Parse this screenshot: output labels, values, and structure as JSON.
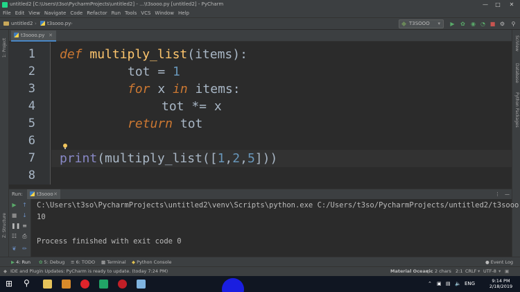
{
  "window": {
    "title": "untitled2 [C:\\Users\\t3so\\PycharmProjects\\untitled2] - ...\\t3sooo.py [untitled2] - PyCharm"
  },
  "menu": [
    "File",
    "Edit",
    "View",
    "Navigate",
    "Code",
    "Refactor",
    "Run",
    "Tools",
    "VCS",
    "Window",
    "Help"
  ],
  "breadcrumb": {
    "project": "untitled2",
    "file": "t3sooo.py"
  },
  "run_config": "T3SOOO",
  "left_strip": {
    "project": "1: Project",
    "structure": "Z: Structure",
    "favorites": "2: Favorites"
  },
  "right_strip": {
    "sciview": "SciView",
    "database": "Database",
    "python_packages": "Python Packages"
  },
  "editor": {
    "tab_label": "t3sooo.py",
    "line_numbers": [
      "1",
      "2",
      "3",
      "4",
      "5",
      "6",
      "7",
      "8"
    ],
    "code": {
      "l1_kw": "def",
      "l1_fn": "multiply_list",
      "l1_rest": "(items):",
      "l2_a": "tot = ",
      "l2_num": "1",
      "l3_kw1": "for",
      "l3_mid": " x ",
      "l3_kw2": "in",
      "l3_rest": " items:",
      "l4": "tot *= x",
      "l5_kw": "return",
      "l5_rest": " tot",
      "l7_bi": "print",
      "l7_a": "(multiply_list([",
      "l7_n1": "1",
      "l7_c1": ",",
      "l7_n2": "2",
      "l7_c2": ",",
      "l7_n3": "5",
      "l7_end": "]))"
    }
  },
  "run_panel": {
    "label": "Run:",
    "tab": "t3sooo",
    "console_lines": [
      "C:\\Users\\t3so\\PycharmProjects\\untitled2\\venv\\Scripts\\python.exe C:/Users/t3so/PycharmProjects/untitled2/t3sooo.py",
      "10",
      "",
      "Process finished with exit code 0"
    ]
  },
  "tool_tabs": {
    "run": "4: Run",
    "debug": "5: Debug",
    "todo": "6: TODO",
    "terminal": "Terminal",
    "python_console": "Python Console",
    "event_log": "Event Log"
  },
  "status": {
    "message": "IDE and Plugin Updates: PyCharm is ready to update. (today 7:24 PM)",
    "theme": "Material Oceanic",
    "chars": "2 chars",
    "position": "2:1",
    "line_sep": "CRLF",
    "encoding": "UTF-8"
  },
  "taskbar": {
    "time": "9:14 PM",
    "date": "2/18/2019",
    "lang": "ENG"
  },
  "colors": {
    "keyword": "#cc7832",
    "function": "#ffc66d",
    "number": "#6897bb",
    "builtin": "#8888c6",
    "text": "#a9b7c6",
    "background": "#2b2b2b"
  }
}
